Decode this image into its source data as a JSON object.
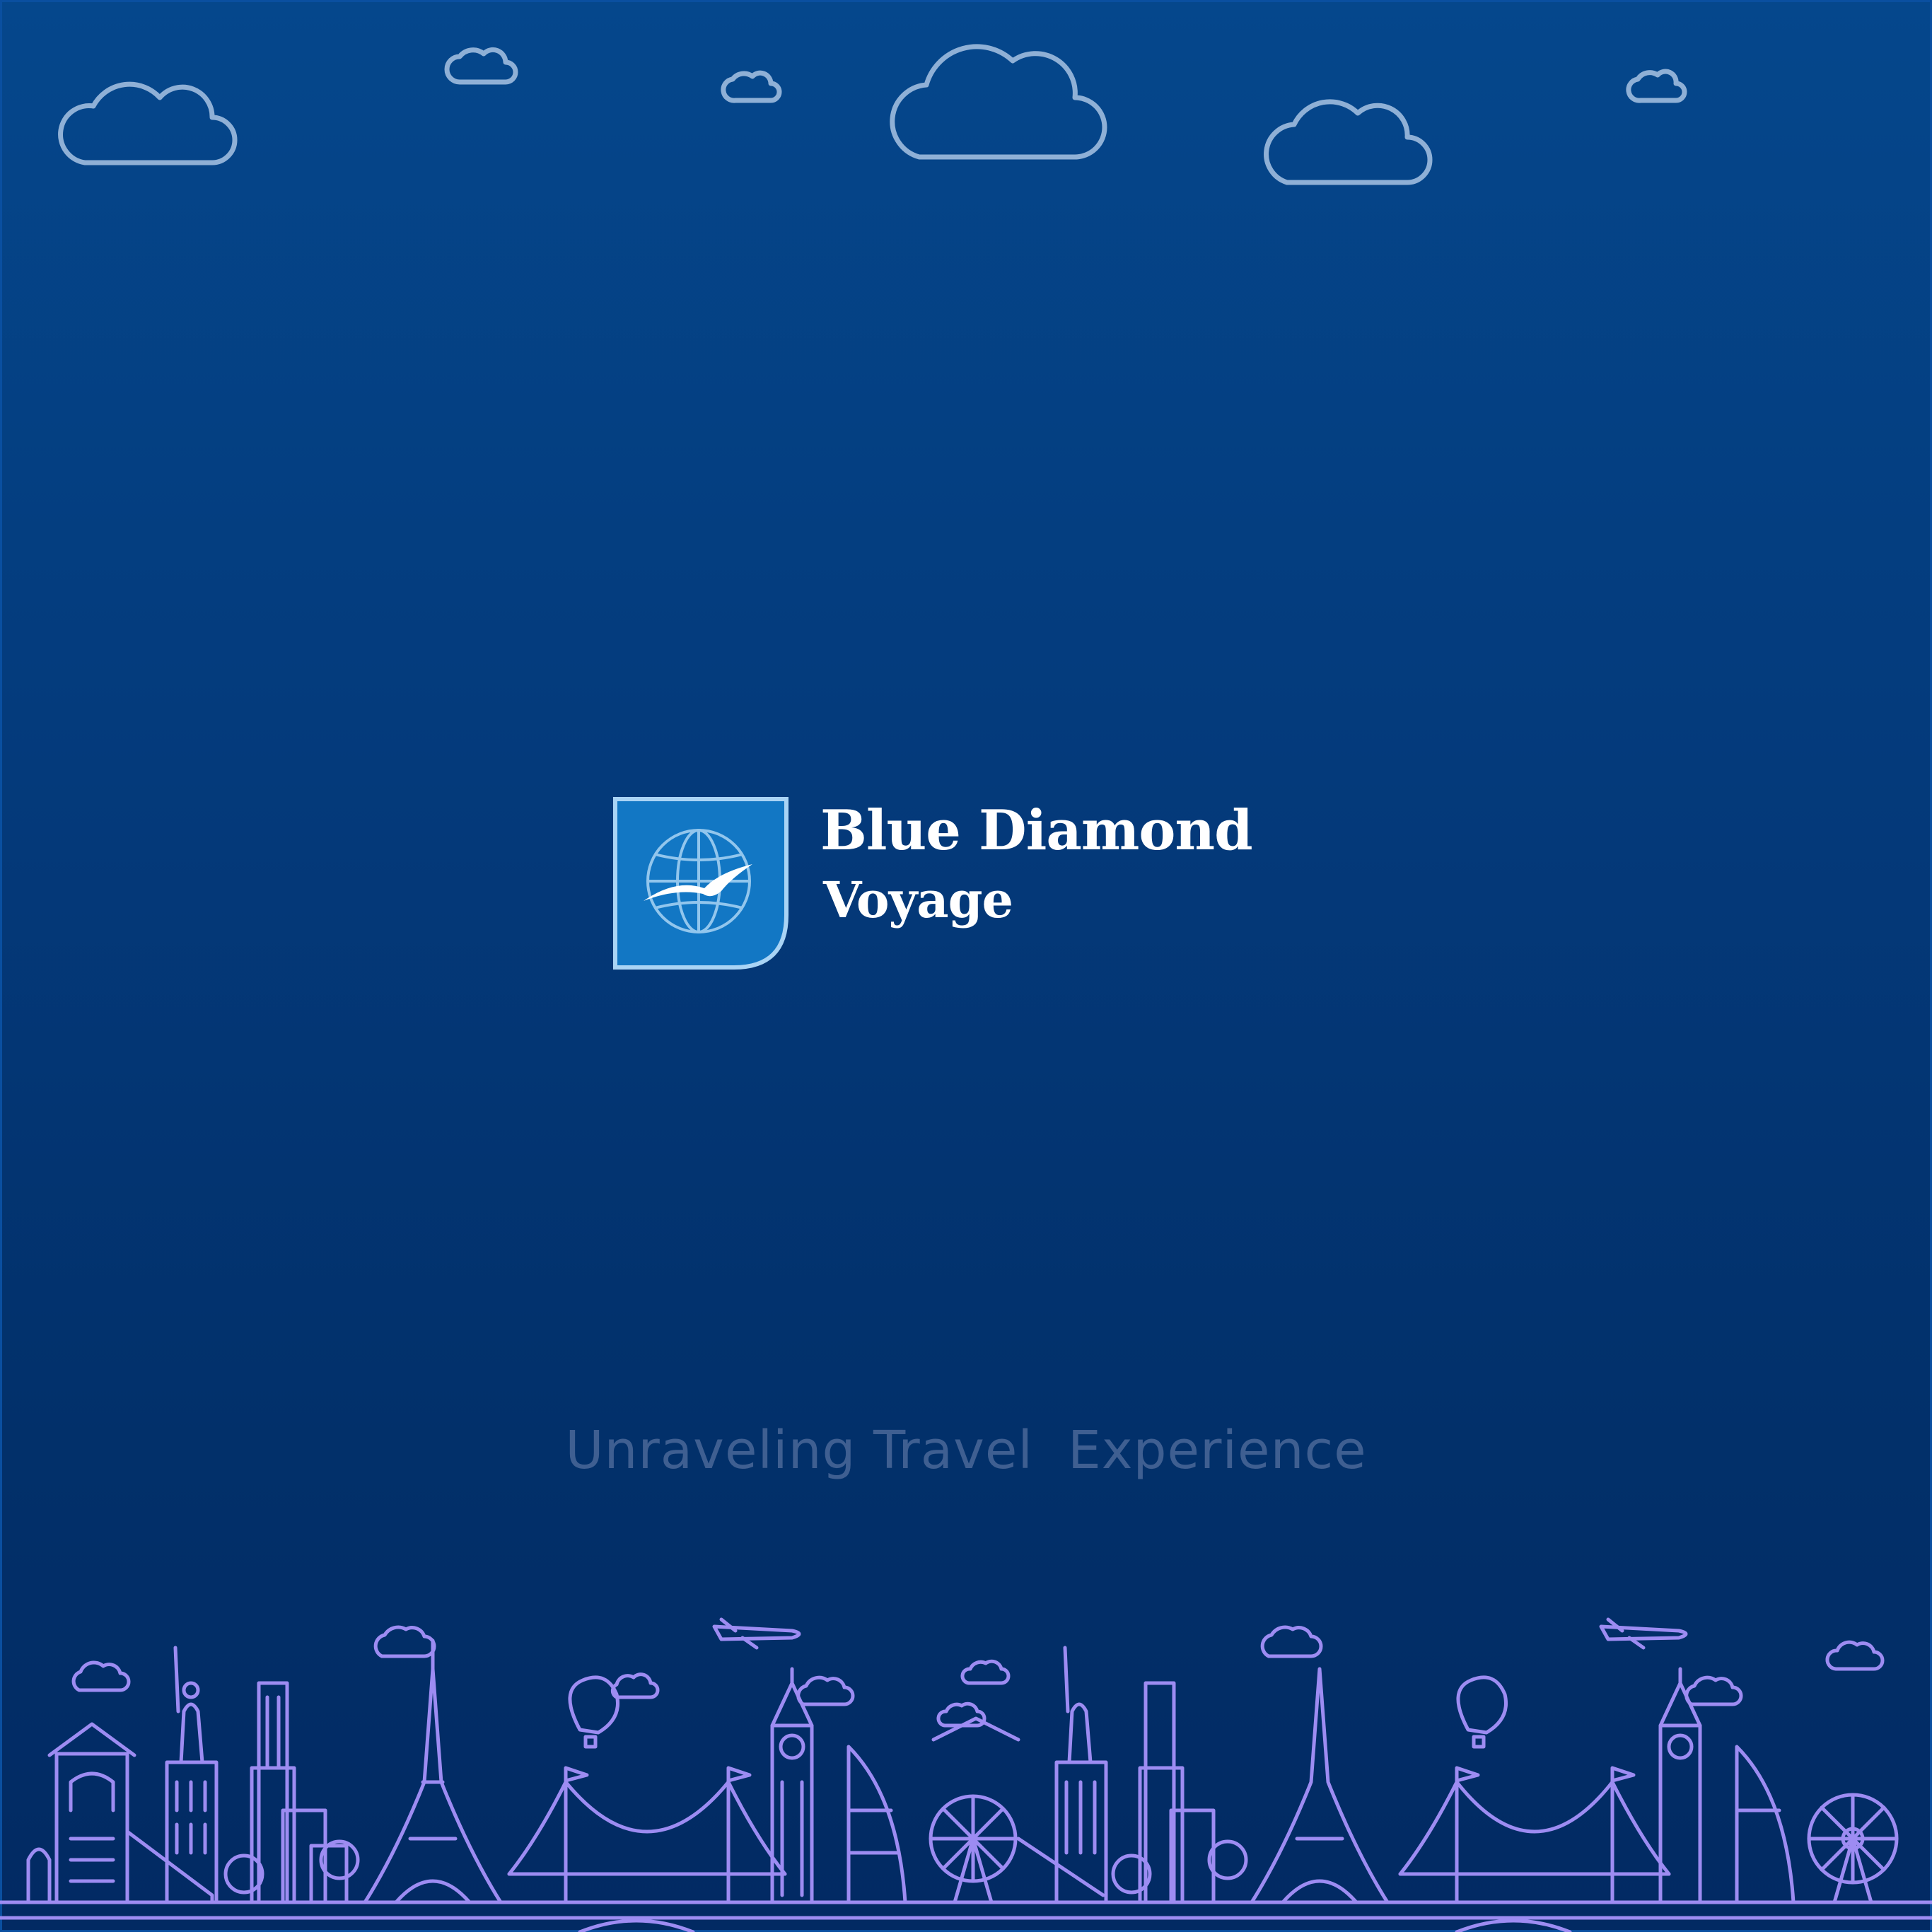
{
  "brand": {
    "name": "Blue Diamond",
    "subtitle": "Voyage"
  },
  "tagline": "Unraveling Travel  Experience",
  "colors": {
    "background_top": "#05478c",
    "background_bottom": "#022a63",
    "cloud_outline": "#8fb0d6",
    "skyline_line": "#9d8cf2",
    "logo_fill": "#1277c4",
    "logo_border": "#a9d4f5",
    "tagline": "#3f5f91"
  },
  "icons": {
    "clouds": "cloud-outline-icons",
    "logo": "globe-seagull-icon",
    "skyline": "world-landmarks-skyline"
  }
}
